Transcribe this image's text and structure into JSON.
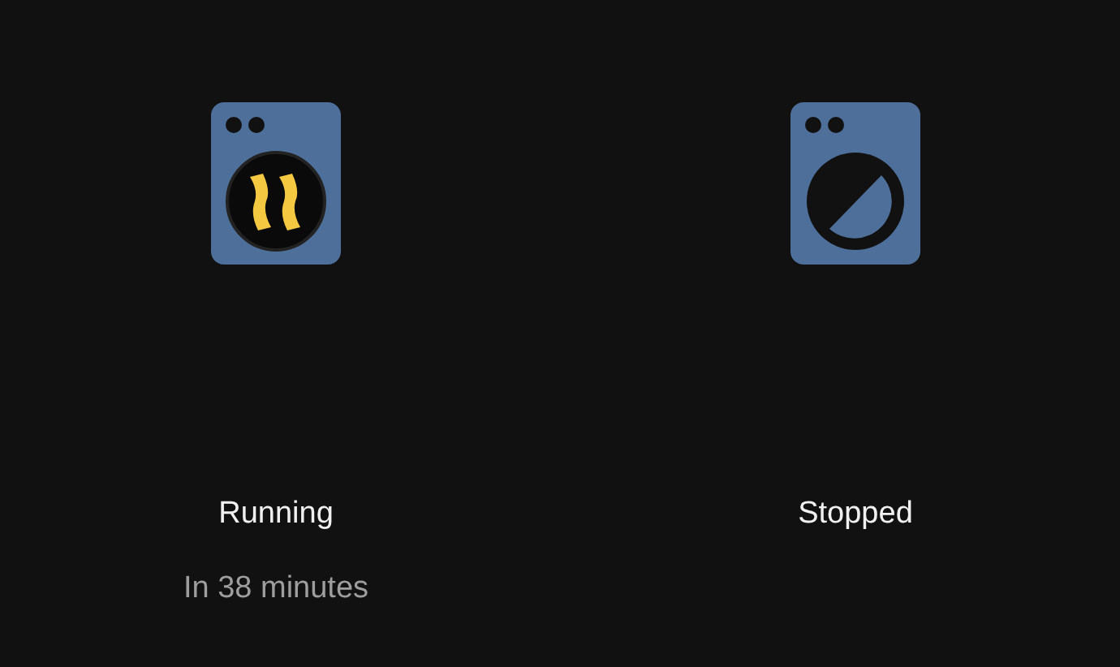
{
  "appliances": [
    {
      "kind": "running",
      "status": "Running",
      "detail": "In 38 minutes"
    },
    {
      "kind": "stopped",
      "status": "Stopped"
    }
  ]
}
